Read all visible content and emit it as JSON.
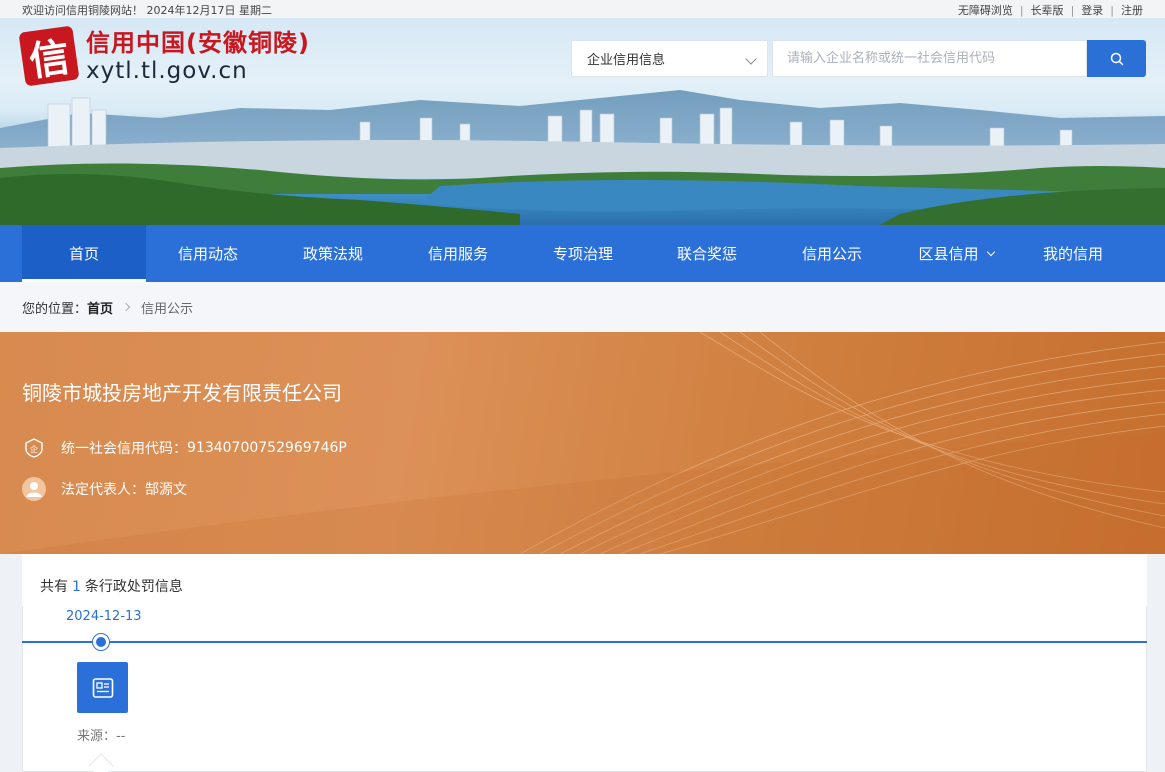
{
  "topbar": {
    "welcome": "欢迎访问信用铜陵网站！ 2024年12月17日 星期二",
    "links": [
      "无障碍浏览",
      "长辈版",
      "登录",
      "注册"
    ]
  },
  "logo": {
    "seal_char": "信",
    "title": "信用中国(安徽铜陵)",
    "url": "xytl.tl.gov.cn"
  },
  "search": {
    "select_value": "企业信用信息",
    "placeholder": "请输入企业名称或统一社会信用代码",
    "button_icon": "search-icon"
  },
  "nav": {
    "items": [
      "首页",
      "信用动态",
      "政策法规",
      "信用服务",
      "专项治理",
      "联合奖惩",
      "信用公示",
      "区县信用",
      "我的信用"
    ],
    "active_index": 0
  },
  "breadcrumb": {
    "prefix": "您的位置：",
    "home": "首页",
    "current": "信用公示"
  },
  "company": {
    "name": "铜陵市城投房地产开发有限责任公司",
    "credit_code_label": "统一社会信用代码：",
    "credit_code": "91340700752969746P",
    "legal_rep_label": "法定代表人：",
    "legal_rep": "郜源文"
  },
  "records": {
    "count_prefix": "共有",
    "count": "1",
    "count_suffix": "条行政处罚信息",
    "date": "2024-12-13",
    "source_label": "来源：",
    "source_value": "--"
  },
  "colors": {
    "primary_blue": "#2b70d8",
    "banner_orange": "#d88a4f",
    "logo_red": "#c8171e"
  }
}
